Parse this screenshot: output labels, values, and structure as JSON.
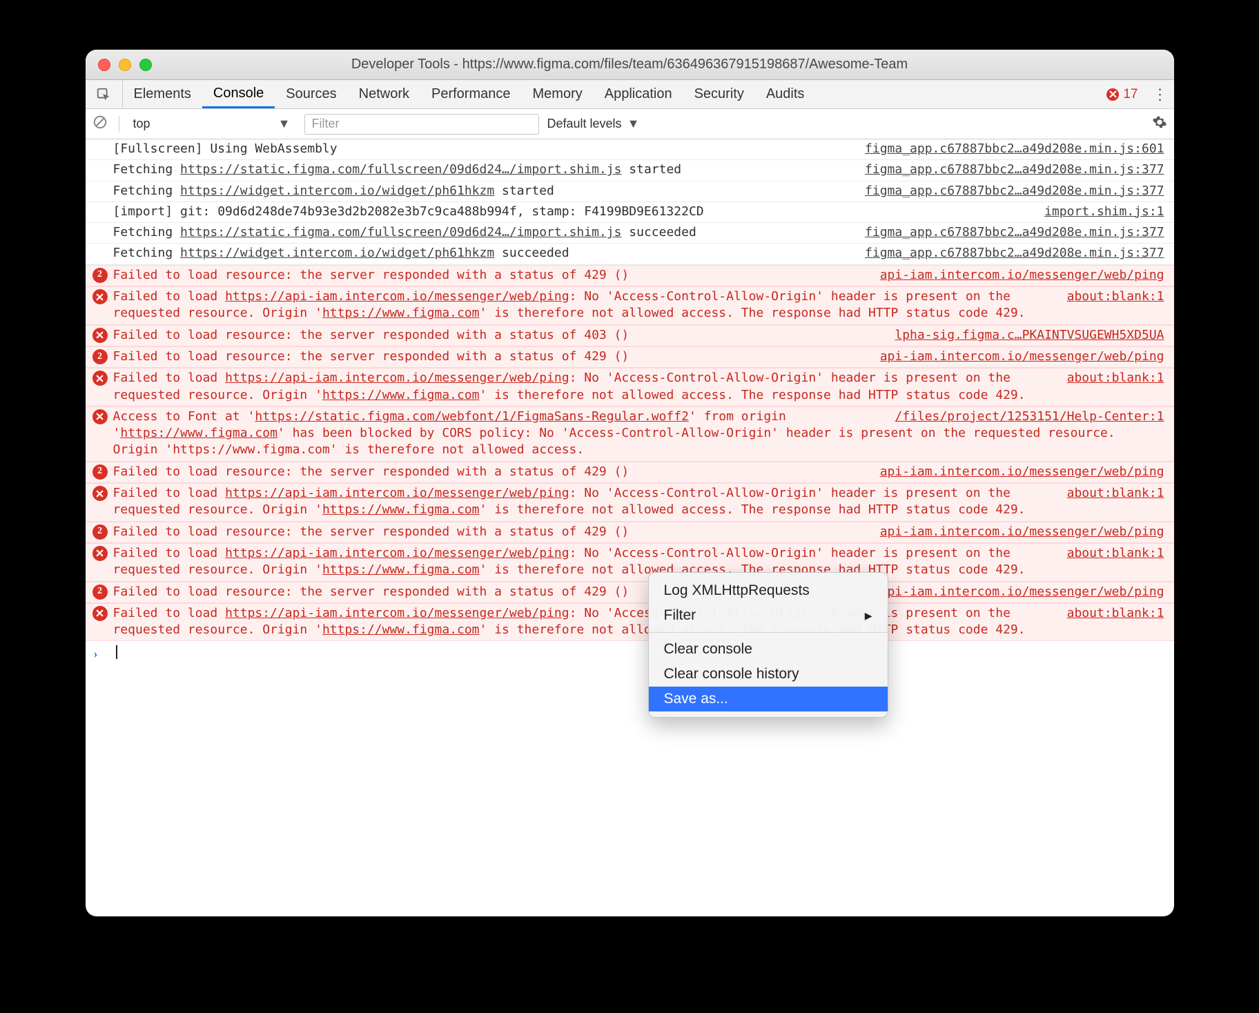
{
  "window": {
    "title": "Developer Tools - https://www.figma.com/files/team/636496367915198687/Awesome-Team"
  },
  "tabs": {
    "items": [
      "Elements",
      "Console",
      "Sources",
      "Network",
      "Performance",
      "Memory",
      "Application",
      "Security",
      "Audits"
    ],
    "active": "Console",
    "error_count": "17"
  },
  "filterbar": {
    "context": "top",
    "filter_placeholder": "Filter",
    "levels": "Default levels"
  },
  "context_menu": {
    "items": [
      {
        "label": "Log XMLHttpRequests",
        "submenu": false
      },
      {
        "label": "Filter",
        "submenu": true
      },
      {
        "sep": true
      },
      {
        "label": "Clear console",
        "submenu": false
      },
      {
        "label": "Clear console history",
        "submenu": false
      },
      {
        "label": "Save as...",
        "submenu": false,
        "selected": true
      }
    ]
  },
  "log": [
    {
      "type": "info",
      "msg_pre": "[Fullscreen] Using WebAssembly",
      "src": "figma_app.c67887bbc2…a49d208e.min.js:601"
    },
    {
      "type": "info",
      "msg_pre": "Fetching ",
      "link": "https://static.figma.com/fullscreen/09d6d24…/import.shim.js",
      "msg_post": " started",
      "src": "figma_app.c67887bbc2…a49d208e.min.js:377"
    },
    {
      "type": "info",
      "msg_pre": "Fetching ",
      "link": "https://widget.intercom.io/widget/ph61hkzm",
      "msg_post": " started",
      "src": "figma_app.c67887bbc2…a49d208e.min.js:377"
    },
    {
      "type": "info",
      "msg_pre": "[import] git: 09d6d248de74b93e3d2b2082e3b7c9ca488b994f, stamp: F4199BD9E61322CD",
      "src": "import.shim.js:1"
    },
    {
      "type": "info",
      "msg_pre": "Fetching ",
      "link": "https://static.figma.com/fullscreen/09d6d24…/import.shim.js",
      "msg_post": " succeeded",
      "src": "figma_app.c67887bbc2…a49d208e.min.js:377"
    },
    {
      "type": "info",
      "msg_pre": "Fetching ",
      "link": "https://widget.intercom.io/widget/ph61hkzm",
      "msg_post": " succeeded",
      "src": "figma_app.c67887bbc2…a49d208e.min.js:377"
    },
    {
      "type": "error",
      "count": "2",
      "msg_pre": "Failed to load resource: the server responded with a status of 429 ()",
      "src": "api-iam.intercom.io/messenger/web/ping"
    },
    {
      "type": "error",
      "err": true,
      "msg_pre": "Failed to load ",
      "link": "https://api-iam.intercom.io/messenger/web/ping",
      "msg_mid": ": No 'Access-Control-Allow-Origin' header is present on the requested resource. Origin '",
      "link2": "https://www.figma.com",
      "msg_post": "' is therefore not allowed access. The response had HTTP status code 429.",
      "src": "about:blank:1"
    },
    {
      "type": "error",
      "err": true,
      "msg_pre": "Failed to load resource: the server responded with a status of 403 ()",
      "src": "lpha-sig.figma.c…PKAINTVSUGEWH5XD5UA"
    },
    {
      "type": "error",
      "count": "2",
      "msg_pre": "Failed to load resource: the server responded with a status of 429 ()",
      "src": "api-iam.intercom.io/messenger/web/ping"
    },
    {
      "type": "error",
      "err": true,
      "msg_pre": "Failed to load ",
      "link": "https://api-iam.intercom.io/messenger/web/ping",
      "msg_mid": ": No 'Access-Control-Allow-Origin' header is present on the requested resource. Origin '",
      "link2": "https://www.figma.com",
      "msg_post": "' is therefore not allowed access. The response had HTTP status code 429.",
      "src": "about:blank:1"
    },
    {
      "type": "error",
      "err": true,
      "msg_pre": "Access to Font at '",
      "link": "https://static.figma.com/webfont/1/FigmaSans-Regular.woff2",
      "msg_mid": "' from origin '",
      "link2": "https://www.figma.com",
      "msg_post": "' has been blocked by CORS policy: No 'Access-Control-Allow-Origin' header is present on the requested resource. Origin 'https://www.figma.com' is therefore not allowed access.",
      "src": "/files/project/1253151/Help-Center:1"
    },
    {
      "type": "error",
      "count": "2",
      "msg_pre": "Failed to load resource: the server responded with a status of 429 ()",
      "src": "api-iam.intercom.io/messenger/web/ping"
    },
    {
      "type": "error",
      "err": true,
      "msg_pre": "Failed to load ",
      "link": "https://api-iam.intercom.io/messenger/web/ping",
      "msg_mid": ": No 'Access-Control-Allow-Origin' header is present on the requested resource. Origin '",
      "link2": "https://www.figma.com",
      "msg_post": "' is therefore not allowed access. The response had HTTP status code 429.",
      "src": "about:blank:1"
    },
    {
      "type": "error",
      "count": "2",
      "msg_pre": "Failed to load resource: the server responded with a status of 429 ()",
      "src": "api-iam.intercom.io/messenger/web/ping"
    },
    {
      "type": "error",
      "err": true,
      "msg_pre": "Failed to load ",
      "link": "https://api-iam.intercom.io/messenger/web/ping",
      "msg_mid": ": No 'Access-Control-Allow-Origin' header is present on the requested resource. Origin '",
      "link2": "https://www.figma.com",
      "msg_post": "' is therefore not allowed access. The response had HTTP status code 429.",
      "src": "about:blank:1"
    },
    {
      "type": "error",
      "count": "2",
      "msg_pre": "Failed to load resource: the server responded with a status of 429 ()",
      "src": "api-iam.intercom.io/messenger/web/ping"
    },
    {
      "type": "error",
      "err": true,
      "msg_pre": "Failed to load ",
      "link": "https://api-iam.intercom.io/messenger/web/ping",
      "msg_mid": ": No 'Access-Control-Allow-Origin' header is present on the requested resource. Origin '",
      "link2": "https://www.figma.com",
      "msg_post": "' is therefore not allowed access. The response had HTTP status code 429.",
      "src": "about:blank:1"
    }
  ]
}
